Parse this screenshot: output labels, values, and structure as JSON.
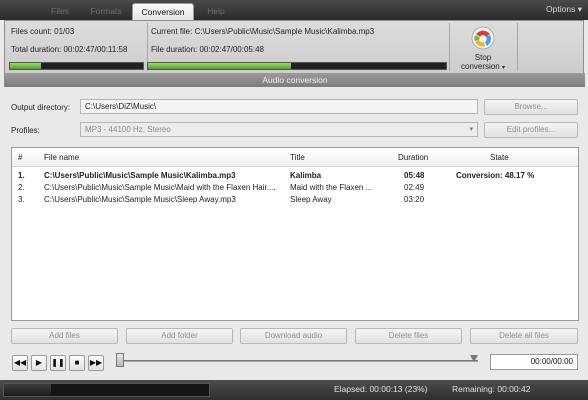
{
  "tabs": [
    "Files",
    "Formats",
    "Conversion",
    "Help"
  ],
  "options_label": "Options",
  "info": {
    "files_count": "Files count: 01/03",
    "total_duration": "Total duration: 00:02:47/00:11:58",
    "current_file": "Current file: C:\\Users\\Public\\Music\\Sample Music\\Kalimba.mp3",
    "file_duration": "File duration: 00:02:47/00:05:48",
    "total_progress": 0.23,
    "file_progress": 0.48,
    "section_title": "Audio conversion",
    "stop_line1": "Stop",
    "stop_line2": "conversion"
  },
  "form": {
    "output_label": "Output directory:",
    "output_value": "C:\\Users\\DiZ\\Music\\",
    "browse_label": "Browse...",
    "profiles_label": "Profiles:",
    "profile_value": "MP3 - 44100 Hz, Stereo",
    "edit_profiles_label": "Edit profiles..."
  },
  "table": {
    "headers": [
      "#",
      "File name",
      "Title",
      "Duration",
      "State"
    ],
    "rows": [
      {
        "num": "1.",
        "file": "C:\\Users\\Public\\Music\\Sample Music\\Kalimba.mp3",
        "title": "Kalimba",
        "duration": "05:48",
        "state": "Conversion: 48.17 %"
      },
      {
        "num": "2.",
        "file": "C:\\Users\\Public\\Music\\Sample Music\\Maid with the Flaxen Hair....",
        "title": "Maid with the Flaxen ...",
        "duration": "02:49",
        "state": ""
      },
      {
        "num": "3.",
        "file": "C:\\Users\\Public\\Music\\Sample Music\\Sleep Away.mp3",
        "title": "Sleep Away",
        "duration": "03:20",
        "state": ""
      }
    ]
  },
  "actions": {
    "add_files": "Add files",
    "add_folder": "Add folder",
    "download_audio": "Download audio",
    "delete_files": "Delete files",
    "delete_all_files": "Delete all files"
  },
  "player": {
    "time": "00:00/00:00",
    "seek_position": 0.0
  },
  "status": {
    "elapsed": "Elapsed: 00:00:13 (23%)",
    "remaining": "Remaining: 00:00:42",
    "progress": 0.23
  }
}
